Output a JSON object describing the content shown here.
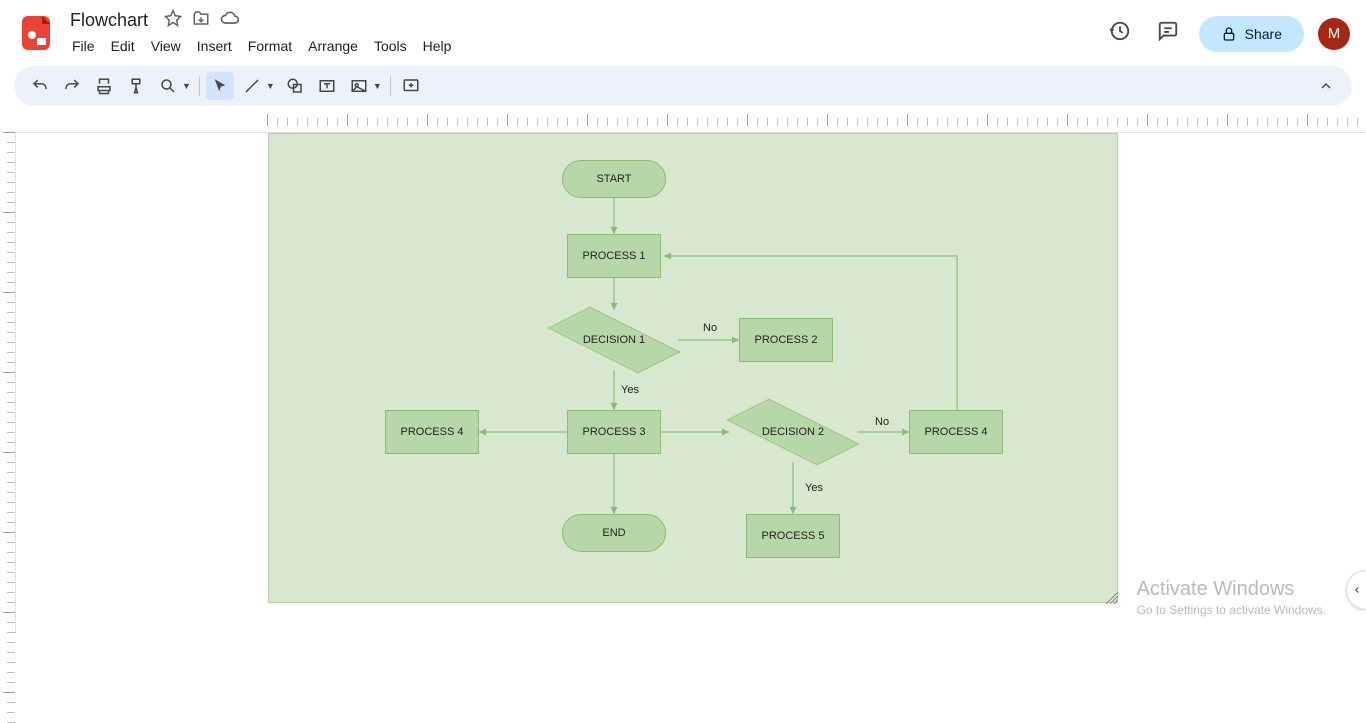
{
  "document": {
    "title": "Flowchart"
  },
  "menu": {
    "file": "File",
    "edit": "Edit",
    "view": "View",
    "insert": "Insert",
    "format": "Format",
    "arrange": "Arrange",
    "tools": "Tools",
    "help": "Help"
  },
  "share": {
    "label": "Share"
  },
  "avatar": {
    "initial": "M"
  },
  "flowchart": {
    "nodes": {
      "start": {
        "label": "START",
        "type": "terminator"
      },
      "process1": {
        "label": "PROCESS 1",
        "type": "process"
      },
      "decision1": {
        "label": "DECISION 1",
        "type": "decision"
      },
      "process2": {
        "label": "PROCESS 2",
        "type": "process"
      },
      "process3": {
        "label": "PROCESS 3",
        "type": "process"
      },
      "process4l": {
        "label": "PROCESS 4",
        "type": "process"
      },
      "decision2": {
        "label": "DECISION 2",
        "type": "decision"
      },
      "process4r": {
        "label": "PROCESS 4",
        "type": "process"
      },
      "end": {
        "label": "END",
        "type": "terminator"
      },
      "process5": {
        "label": "PROCESS 5",
        "type": "process"
      }
    },
    "edge_labels": {
      "d1_no": "No",
      "d1_yes": "Yes",
      "d2_no": "No",
      "d2_yes": "Yes"
    }
  },
  "watermark": {
    "title": "Activate Windows",
    "subtitle": "Go to Settings to activate Windows."
  }
}
